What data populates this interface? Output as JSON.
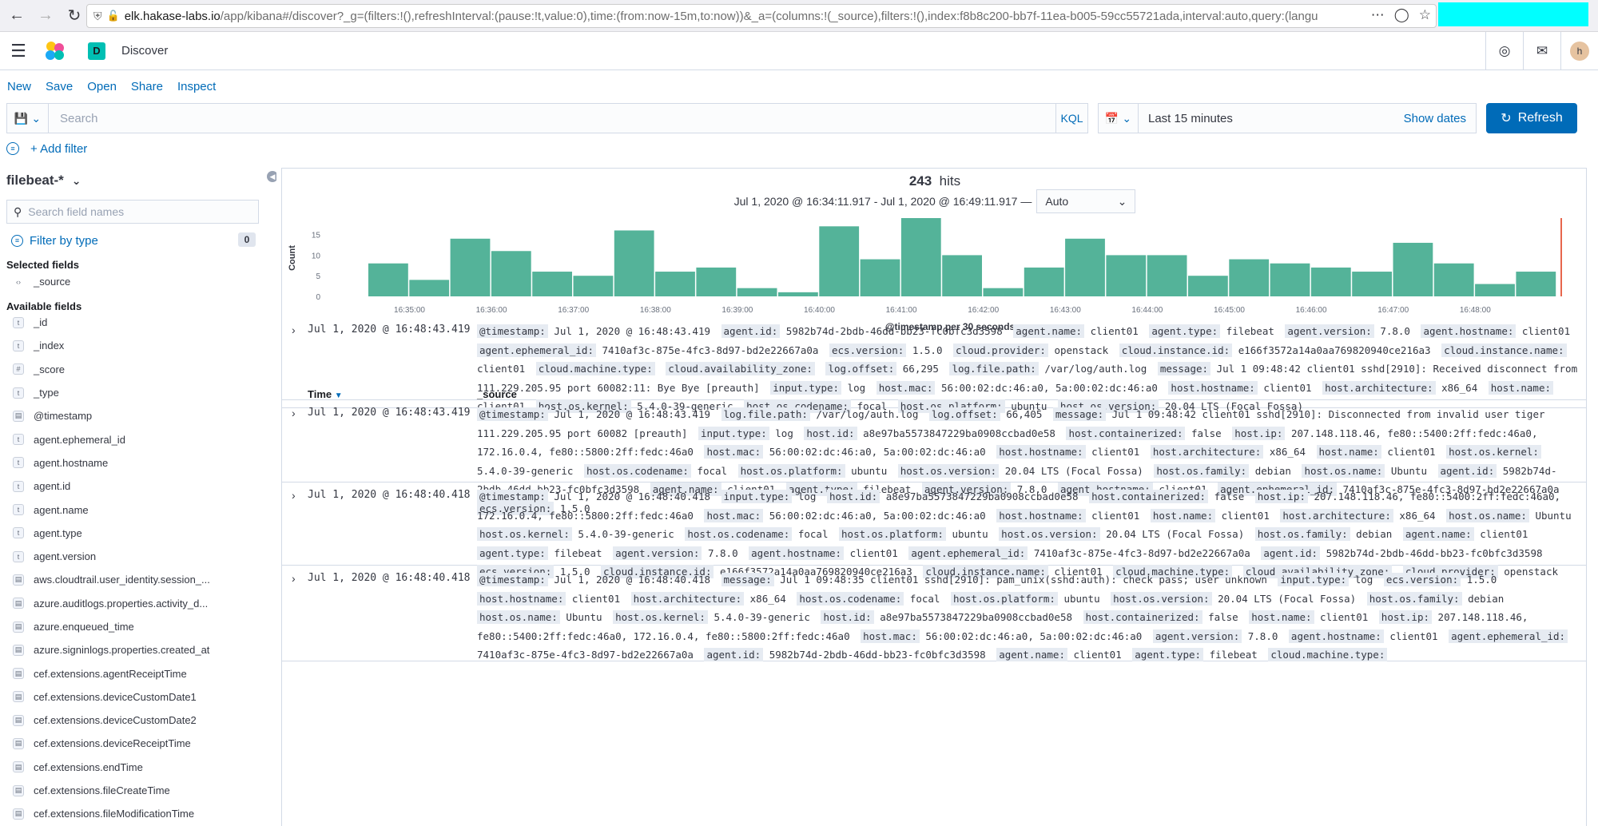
{
  "browser": {
    "url_host": "elk.hakase-labs.io",
    "url_path": "/app/kibana#/discover?_g=(filters:!(),refreshInterval:(pause:!t,value:0),time:(from:now-15m,to:now))&_a=(columns:!(_source),filters:!(),index:f8b8c200-bb7f-11ea-b005-59cc55721ada,interval:auto,query:(langu"
  },
  "header": {
    "space_initial": "D",
    "app_title": "Discover",
    "avatar_initial": "h"
  },
  "topnav": {
    "new": "New",
    "save": "Save",
    "open": "Open",
    "share": "Share",
    "inspect": "Inspect"
  },
  "query": {
    "placeholder": "Search",
    "language": "KQL",
    "time_range": "Last 15 minutes",
    "show_dates": "Show dates",
    "refresh": "Refresh"
  },
  "filters": {
    "add_filter": "+ Add filter"
  },
  "sidebar": {
    "index_pattern": "filebeat-*",
    "search_placeholder": "Search field names",
    "filter_by_type": "Filter by type",
    "filter_count": "0",
    "selected_heading": "Selected fields",
    "selected_fields": [
      {
        "type": "src",
        "name": "_source"
      }
    ],
    "available_heading": "Available fields",
    "available_fields": [
      {
        "type": "t",
        "name": "_id"
      },
      {
        "type": "t",
        "name": "_index"
      },
      {
        "type": "#",
        "name": "_score"
      },
      {
        "type": "t",
        "name": "_type"
      },
      {
        "type": "date",
        "name": "@timestamp"
      },
      {
        "type": "t",
        "name": "agent.ephemeral_id"
      },
      {
        "type": "t",
        "name": "agent.hostname"
      },
      {
        "type": "t",
        "name": "agent.id"
      },
      {
        "type": "t",
        "name": "agent.name"
      },
      {
        "type": "t",
        "name": "agent.type"
      },
      {
        "type": "t",
        "name": "agent.version"
      },
      {
        "type": "date",
        "name": "aws.cloudtrail.user_identity.session_..."
      },
      {
        "type": "date",
        "name": "azure.auditlogs.properties.activity_d..."
      },
      {
        "type": "date",
        "name": "azure.enqueued_time"
      },
      {
        "type": "date",
        "name": "azure.signinlogs.properties.created_at"
      },
      {
        "type": "date",
        "name": "cef.extensions.agentReceiptTime"
      },
      {
        "type": "date",
        "name": "cef.extensions.deviceCustomDate1"
      },
      {
        "type": "date",
        "name": "cef.extensions.deviceCustomDate2"
      },
      {
        "type": "date",
        "name": "cef.extensions.deviceReceiptTime"
      },
      {
        "type": "date",
        "name": "cef.extensions.endTime"
      },
      {
        "type": "date",
        "name": "cef.extensions.fileCreateTime"
      },
      {
        "type": "date",
        "name": "cef.extensions.fileModificationTime"
      }
    ]
  },
  "results": {
    "hits_count": "243",
    "hits_label": "hits",
    "range_text": "Jul 1, 2020 @ 16:34:11.917 - Jul 1, 2020 @ 16:49:11.917 —",
    "interval": "Auto",
    "columns": {
      "time": "Time",
      "source": "_source"
    }
  },
  "chart_data": {
    "type": "bar",
    "ylabel": "Count",
    "xlabel": "@timestamp per 30 seconds",
    "ylim": [
      0,
      19
    ],
    "yticks": [
      0,
      5,
      10,
      15
    ],
    "x_tick_labels": [
      "16:35:00",
      "16:36:00",
      "16:37:00",
      "16:38:00",
      "16:39:00",
      "16:40:00",
      "16:41:00",
      "16:42:00",
      "16:43:00",
      "16:44:00",
      "16:45:00",
      "16:46:00",
      "16:47:00",
      "16:48:00"
    ],
    "values": [
      8,
      4,
      14,
      11,
      6,
      5,
      16,
      6,
      7,
      2,
      1,
      17,
      9,
      19,
      10,
      2,
      7,
      14,
      10,
      10,
      5,
      9,
      8,
      7,
      6,
      13,
      8,
      3,
      6
    ],
    "bar_color": "#54b399",
    "now_marker_color": "#e7664c"
  },
  "rows": [
    {
      "time": "Jul 1, 2020 @ 16:48:43.419",
      "fields": [
        [
          "@timestamp:",
          "Jul 1, 2020 @ 16:48:43.419"
        ],
        [
          "agent.id:",
          "5982b74d-2bdb-46dd-bb23-fc0bfc3d3598"
        ],
        [
          "agent.name:",
          "client01"
        ],
        [
          "agent.type:",
          "filebeat"
        ],
        [
          "agent.version:",
          "7.8.0"
        ],
        [
          "agent.hostname:",
          "client01"
        ],
        [
          "agent.ephemeral_id:",
          "7410af3c-875e-4fc3-8d97-bd2e22667a0a"
        ],
        [
          "ecs.version:",
          "1.5.0"
        ],
        [
          "cloud.provider:",
          "openstack"
        ],
        [
          "cloud.instance.id:",
          "e166f3572a14a0aa769820940ce216a3"
        ],
        [
          "cloud.instance.name:",
          "client01"
        ],
        [
          "cloud.machine.type:",
          ""
        ],
        [
          "cloud.availability_zone:",
          ""
        ],
        [
          "log.offset:",
          "66,295"
        ],
        [
          "log.file.path:",
          "/var/log/auth.log"
        ],
        [
          "message:",
          "Jul 1 09:48:42 client01 sshd[2910]: Received disconnect from 111.229.205.95 port 60082:11: Bye Bye [preauth]"
        ],
        [
          "input.type:",
          "log"
        ],
        [
          "host.mac:",
          "56:00:02:dc:46:a0, 5a:00:02:dc:46:a0"
        ],
        [
          "host.hostname:",
          "client01"
        ],
        [
          "host.architecture:",
          "x86_64"
        ],
        [
          "host.name:",
          "client01"
        ],
        [
          "host.os.kernel:",
          "5.4.0-39-generic"
        ],
        [
          "host.os.codename:",
          "focal"
        ],
        [
          "host.os.platform:",
          "ubuntu"
        ],
        [
          "host.os.version:",
          "20.04 LTS (Focal Fossa)"
        ]
      ]
    },
    {
      "time": "Jul 1, 2020 @ 16:48:43.419",
      "fields": [
        [
          "@timestamp:",
          "Jul 1, 2020 @ 16:48:43.419"
        ],
        [
          "log.file.path:",
          "/var/log/auth.log"
        ],
        [
          "log.offset:",
          "66,405"
        ],
        [
          "message:",
          "Jul 1 09:48:42 client01 sshd[2910]: Disconnected from invalid user tiger 111.229.205.95 port 60082 [preauth]"
        ],
        [
          "input.type:",
          "log"
        ],
        [
          "host.id:",
          "a8e97ba5573847229ba0908ccbad0e58"
        ],
        [
          "host.containerized:",
          "false"
        ],
        [
          "host.ip:",
          "207.148.118.46, fe80::5400:2ff:fedc:46a0, 172.16.0.4, fe80::5800:2ff:fedc:46a0"
        ],
        [
          "host.mac:",
          "56:00:02:dc:46:a0, 5a:00:02:dc:46:a0"
        ],
        [
          "host.hostname:",
          "client01"
        ],
        [
          "host.architecture:",
          "x86_64"
        ],
        [
          "host.name:",
          "client01"
        ],
        [
          "host.os.kernel:",
          "5.4.0-39-generic"
        ],
        [
          "host.os.codename:",
          "focal"
        ],
        [
          "host.os.platform:",
          "ubuntu"
        ],
        [
          "host.os.version:",
          "20.04 LTS (Focal Fossa)"
        ],
        [
          "host.os.family:",
          "debian"
        ],
        [
          "host.os.name:",
          "Ubuntu"
        ],
        [
          "agent.id:",
          "5982b74d-2bdb-46dd-bb23-fc0bfc3d3598"
        ],
        [
          "agent.name:",
          "client01"
        ],
        [
          "agent.type:",
          "filebeat"
        ],
        [
          "agent.version:",
          "7.8.0"
        ],
        [
          "agent.hostname:",
          "client01"
        ],
        [
          "agent.ephemeral_id:",
          "7410af3c-875e-4fc3-8d97-bd2e22667a0a"
        ],
        [
          "ecs.version:",
          "1.5.0"
        ]
      ]
    },
    {
      "time": "Jul 1, 2020 @ 16:48:40.418",
      "fields": [
        [
          "@timestamp:",
          "Jul 1, 2020 @ 16:48:40.418"
        ],
        [
          "input.type:",
          "log"
        ],
        [
          "host.id:",
          "a8e97ba5573847229ba0908ccbad0e58"
        ],
        [
          "host.containerized:",
          "false"
        ],
        [
          "host.ip:",
          "207.148.118.46, fe80::5400:2ff:fedc:46a0, 172.16.0.4, fe80::5800:2ff:fedc:46a0"
        ],
        [
          "host.mac:",
          "56:00:02:dc:46:a0, 5a:00:02:dc:46:a0"
        ],
        [
          "host.hostname:",
          "client01"
        ],
        [
          "host.name:",
          "client01"
        ],
        [
          "host.architecture:",
          "x86_64"
        ],
        [
          "host.os.name:",
          "Ubuntu"
        ],
        [
          "host.os.kernel:",
          "5.4.0-39-generic"
        ],
        [
          "host.os.codename:",
          "focal"
        ],
        [
          "host.os.platform:",
          "ubuntu"
        ],
        [
          "host.os.version:",
          "20.04 LTS (Focal Fossa)"
        ],
        [
          "host.os.family:",
          "debian"
        ],
        [
          "agent.name:",
          "client01"
        ],
        [
          "agent.type:",
          "filebeat"
        ],
        [
          "agent.version:",
          "7.8.0"
        ],
        [
          "agent.hostname:",
          "client01"
        ],
        [
          "agent.ephemeral_id:",
          "7410af3c-875e-4fc3-8d97-bd2e22667a0a"
        ],
        [
          "agent.id:",
          "5982b74d-2bdb-46dd-bb23-fc0bfc3d3598"
        ],
        [
          "ecs.version:",
          "1.5.0"
        ],
        [
          "cloud.instance.id:",
          "e166f3572a14a0aa769820940ce216a3"
        ],
        [
          "cloud.instance.name:",
          "client01"
        ],
        [
          "cloud.machine.type:",
          ""
        ],
        [
          "cloud.availability_zone:",
          ""
        ],
        [
          "cloud.provider:",
          "openstack"
        ]
      ]
    },
    {
      "time": "Jul 1, 2020 @ 16:48:40.418",
      "fields": [
        [
          "@timestamp:",
          "Jul 1, 2020 @ 16:48:40.418"
        ],
        [
          "message:",
          "Jul 1 09:48:35 client01 sshd[2910]: pam_unix(sshd:auth): check pass; user unknown"
        ],
        [
          "input.type:",
          "log"
        ],
        [
          "ecs.version:",
          "1.5.0"
        ],
        [
          "host.hostname:",
          "client01"
        ],
        [
          "host.architecture:",
          "x86_64"
        ],
        [
          "host.os.codename:",
          "focal"
        ],
        [
          "host.os.platform:",
          "ubuntu"
        ],
        [
          "host.os.version:",
          "20.04 LTS (Focal Fossa)"
        ],
        [
          "host.os.family:",
          "debian"
        ],
        [
          "host.os.name:",
          "Ubuntu"
        ],
        [
          "host.os.kernel:",
          "5.4.0-39-generic"
        ],
        [
          "host.id:",
          "a8e97ba5573847229ba0908ccbad0e58"
        ],
        [
          "host.containerized:",
          "false"
        ],
        [
          "host.name:",
          "client01"
        ],
        [
          "host.ip:",
          "207.148.118.46, fe80::5400:2ff:fedc:46a0, 172.16.0.4, fe80::5800:2ff:fedc:46a0"
        ],
        [
          "host.mac:",
          "56:00:02:dc:46:a0, 5a:00:02:dc:46:a0"
        ],
        [
          "agent.version:",
          "7.8.0"
        ],
        [
          "agent.hostname:",
          "client01"
        ],
        [
          "agent.ephemeral_id:",
          "7410af3c-875e-4fc3-8d97-bd2e22667a0a"
        ],
        [
          "agent.id:",
          "5982b74d-2bdb-46dd-bb23-fc0bfc3d3598"
        ],
        [
          "agent.name:",
          "client01"
        ],
        [
          "agent.type:",
          "filebeat"
        ],
        [
          "cloud.machine.type:",
          ""
        ]
      ]
    }
  ]
}
